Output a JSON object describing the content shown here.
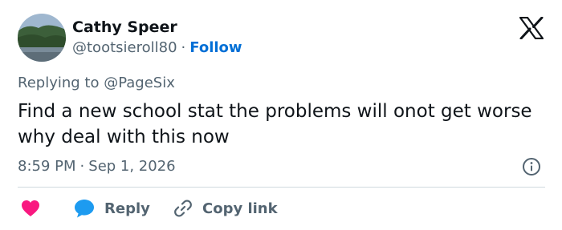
{
  "author": {
    "name": "Cathy Speer",
    "handle": "@tootsieroll80",
    "separator": "·",
    "follow_label": "Follow"
  },
  "reply_context": {
    "prefix": "Replying to",
    "mention": "@PageSix"
  },
  "tweet": {
    "text": "Find a new school stat the problems will onot get worse why deal with this now",
    "time": "8:59 PM",
    "separator": "·",
    "date": "Sep 1, 2026"
  },
  "actions": {
    "reply_label": "Reply",
    "copy_link_label": "Copy link"
  },
  "colors": {
    "text_primary": "#0f1419",
    "text_secondary": "#536471",
    "follow_blue": "#006fd6",
    "heart_pink": "#f91880",
    "reply_blue": "#1d9bf0",
    "divider": "#cfd9de"
  },
  "icons": {
    "brand": "x-logo-icon",
    "info": "info-icon",
    "like": "heart-icon",
    "reply": "speech-bubble-icon",
    "copy": "link-icon"
  }
}
